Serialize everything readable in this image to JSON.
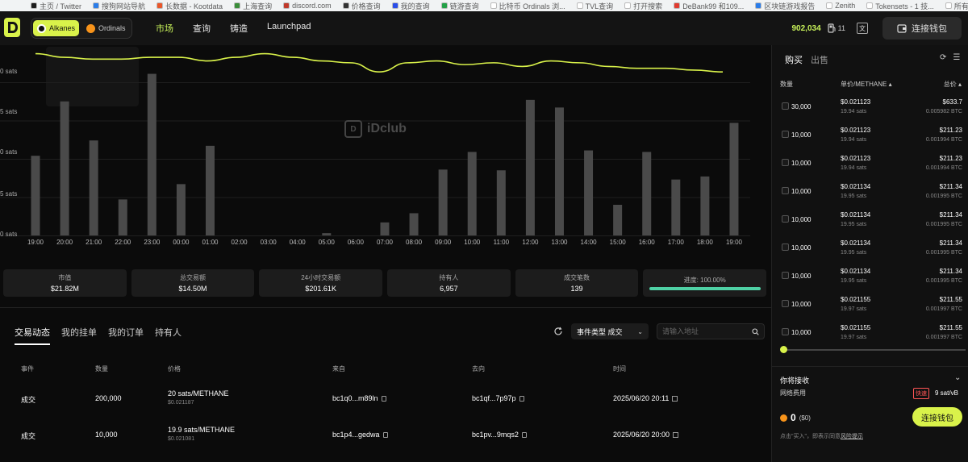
{
  "bookmarks": [
    {
      "label": "主页 / Twitter",
      "color": "#1d1d1d"
    },
    {
      "label": "搜狗网站导航",
      "color": "#2b7de9"
    },
    {
      "label": "长数据 - Kootdata",
      "color": "#e9572b"
    },
    {
      "label": "上海查询",
      "color": "#3a8e3a"
    },
    {
      "label": "discord.com",
      "color": "#c0392b"
    },
    {
      "label": "价格查询",
      "color": "#333333"
    },
    {
      "label": "我的查询",
      "color": "#2b4ee9"
    },
    {
      "label": "链游查询",
      "color": "#24a148"
    },
    {
      "label": "比特币 Ordinals 浏...",
      "color": "#ffffff"
    },
    {
      "label": "TVL查询",
      "color": "#ffffff"
    },
    {
      "label": "打开搜索",
      "color": "#ffffff"
    },
    {
      "label": "DeBank99 和109...",
      "color": "#e03c31"
    },
    {
      "label": "区块链游戏报告",
      "color": "#2b7de9"
    },
    {
      "label": "Zenith",
      "color": "#ffffff"
    },
    {
      "label": "Tokensets - 1 技...",
      "color": "#ffffff"
    },
    {
      "label": "所有书签",
      "color": "#ffffff"
    }
  ],
  "header": {
    "chains": [
      {
        "label": "Alkanes",
        "active": true
      },
      {
        "label": "Ordinals",
        "active": false
      }
    ],
    "nav": [
      {
        "label": "市场",
        "active": true
      },
      {
        "label": "查询",
        "active": false
      },
      {
        "label": "铸造",
        "active": false
      },
      {
        "label": "Launchpad",
        "active": false
      }
    ],
    "block_height": "902,034",
    "gas": "11",
    "connect_wallet": "连接钱包"
  },
  "chart_data": {
    "type": "bar",
    "categories": [
      "19:00",
      "20:00",
      "21:00",
      "22:00",
      "23:00",
      "00:00",
      "01:00",
      "02:00",
      "03:00",
      "04:00",
      "05:00",
      "06:00",
      "07:00",
      "08:00",
      "09:00",
      "10:00",
      "11:00",
      "12:00",
      "13:00",
      "14:00",
      "15:00",
      "16:00",
      "17:00",
      "18:00",
      "19:00"
    ],
    "values": [
      104,
      175,
      124,
      47,
      211,
      67,
      117,
      0,
      0,
      0,
      3,
      0,
      17,
      29,
      86,
      109,
      85,
      177,
      167,
      111,
      40,
      109,
      73,
      77,
      147
    ],
    "line": [
      25.1,
      24.9,
      24.8,
      24.8,
      24.9,
      24.9,
      24.7,
      24.9,
      25.1,
      24.9,
      24.7,
      24.6,
      24.1,
      24.6,
      24.7,
      24.5,
      24.6,
      24.4,
      24.7,
      24.6,
      24.4,
      24.3,
      24.3,
      24.2,
      24.1
    ],
    "y_ticks": [
      "0 sats",
      "5 sats",
      "0 sats",
      "5 sats",
      "0 sats"
    ],
    "ylim": [
      0,
      240
    ],
    "line_color": "#d9f24a",
    "bar_color": "#4a4a4a",
    "watermark": "iDclub",
    "grid": true
  },
  "stats": [
    {
      "label": "市值",
      "value": "$21.82M"
    },
    {
      "label": "总交易额",
      "value": "$14.50M"
    },
    {
      "label": "24小时交易额",
      "value": "$201.61K"
    },
    {
      "label": "持有人",
      "value": "6,957"
    },
    {
      "label": "成交笔数",
      "value": "139"
    }
  ],
  "progress": {
    "label": "进度: 100.00%",
    "fraction": 1.0
  },
  "activity": {
    "tabs": [
      {
        "label": "交易动态",
        "active": true
      },
      {
        "label": "我的挂单",
        "active": false
      },
      {
        "label": "我的订单",
        "active": false
      },
      {
        "label": "持有人",
        "active": false
      }
    ],
    "event_type": "事件类型 成交",
    "search_placeholder": "请输入地址",
    "columns": [
      "事件",
      "数量",
      "价格",
      "来自",
      "去向",
      "时间"
    ],
    "rows": [
      {
        "event": "成交",
        "qty": "200,000",
        "price": "20 sats/METHANE",
        "price_usd": "$0.021187",
        "from": "bc1q0...m89ln",
        "to": "bc1qf...7p97p",
        "time": "2025/06/20 20:11"
      },
      {
        "event": "成交",
        "qty": "10,000",
        "price": "19.9 sats/METHANE",
        "price_usd": "$0.021081",
        "from": "bc1p4...gedwa",
        "to": "bc1pv...9mqs2",
        "time": "2025/06/20 20:00"
      }
    ]
  },
  "panel": {
    "tabs": [
      {
        "label": "购买",
        "active": true
      },
      {
        "label": "出售",
        "active": false
      }
    ],
    "columns": {
      "qty": "数量",
      "price": "单价/METHANE",
      "total": "总价"
    },
    "orders": [
      {
        "qty": "30,000",
        "price": "$0.021123",
        "sats": "19.94 sats",
        "total": "$633.7",
        "btc": "0.005982 BTC"
      },
      {
        "qty": "10,000",
        "price": "$0.021123",
        "sats": "19.94 sats",
        "total": "$211.23",
        "btc": "0.001994 BTC"
      },
      {
        "qty": "10,000",
        "price": "$0.021123",
        "sats": "19.94 sats",
        "total": "$211.23",
        "btc": "0.001994 BTC"
      },
      {
        "qty": "10,000",
        "price": "$0.021134",
        "sats": "19.95 sats",
        "total": "$211.34",
        "btc": "0.001995 BTC"
      },
      {
        "qty": "10,000",
        "price": "$0.021134",
        "sats": "19.95 sats",
        "total": "$211.34",
        "btc": "0.001995 BTC"
      },
      {
        "qty": "10,000",
        "price": "$0.021134",
        "sats": "19.95 sats",
        "total": "$211.34",
        "btc": "0.001995 BTC"
      },
      {
        "qty": "10,000",
        "price": "$0.021134",
        "sats": "19.95 sats",
        "total": "$211.34",
        "btc": "0.001995 BTC"
      },
      {
        "qty": "10,000",
        "price": "$0.021155",
        "sats": "19.97 sats",
        "total": "$211.55",
        "btc": "0.001997 BTC"
      },
      {
        "qty": "10,000",
        "price": "$0.021155",
        "sats": "19.97 sats",
        "total": "$211.55",
        "btc": "0.001997 BTC"
      }
    ],
    "receive_label": "你将接收",
    "fee_label": "网络费用",
    "fee_badge": "快速",
    "fee_value": "9 sat/vB",
    "btc_amount": "0",
    "btc_usd": "($0)",
    "connect_wallet": "连接钱包",
    "risk_prefix": "点击\"买入\"，即表示同意",
    "risk_link": "风险提示"
  }
}
